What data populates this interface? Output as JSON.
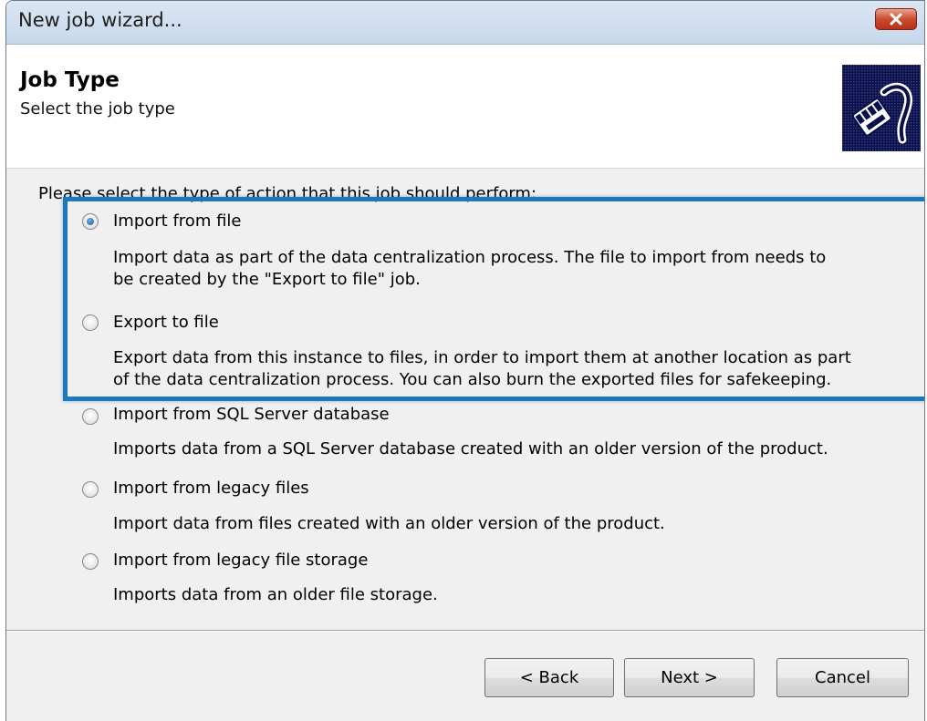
{
  "window": {
    "title": "New job wizard..."
  },
  "header": {
    "title": "Job Type",
    "subtitle": "Select the job type",
    "logo_icon": "network-cable-icon"
  },
  "prompt": "Please select the type of action that this job should perform:",
  "options": [
    {
      "label": "Import from file",
      "description_lines": [
        "Import data as part of the data centralization process. The file to import from needs to",
        "be created by the \"Export to file\" job."
      ],
      "selected": true
    },
    {
      "label": "Export to file",
      "description_lines": [
        "Export data from this instance to files, in order to import them at another location as part",
        "of the data centralization process. You can also burn the exported files for safekeeping."
      ],
      "selected": false
    },
    {
      "label": "Import from SQL Server database",
      "description_lines": [
        "Imports data from a SQL Server database created with an older version of the product."
      ],
      "selected": false
    },
    {
      "label": "Import from legacy files",
      "description_lines": [
        "Import data from files created with an older version of the product."
      ],
      "selected": false
    },
    {
      "label": "Import from legacy file storage",
      "description_lines": [
        "Imports data from an older file storage."
      ],
      "selected": false
    }
  ],
  "buttons": {
    "back": "< Back",
    "next": "Next >",
    "cancel": "Cancel"
  },
  "colors": {
    "highlight": "#1c78b8",
    "logo_background": "#0a0f4e"
  }
}
